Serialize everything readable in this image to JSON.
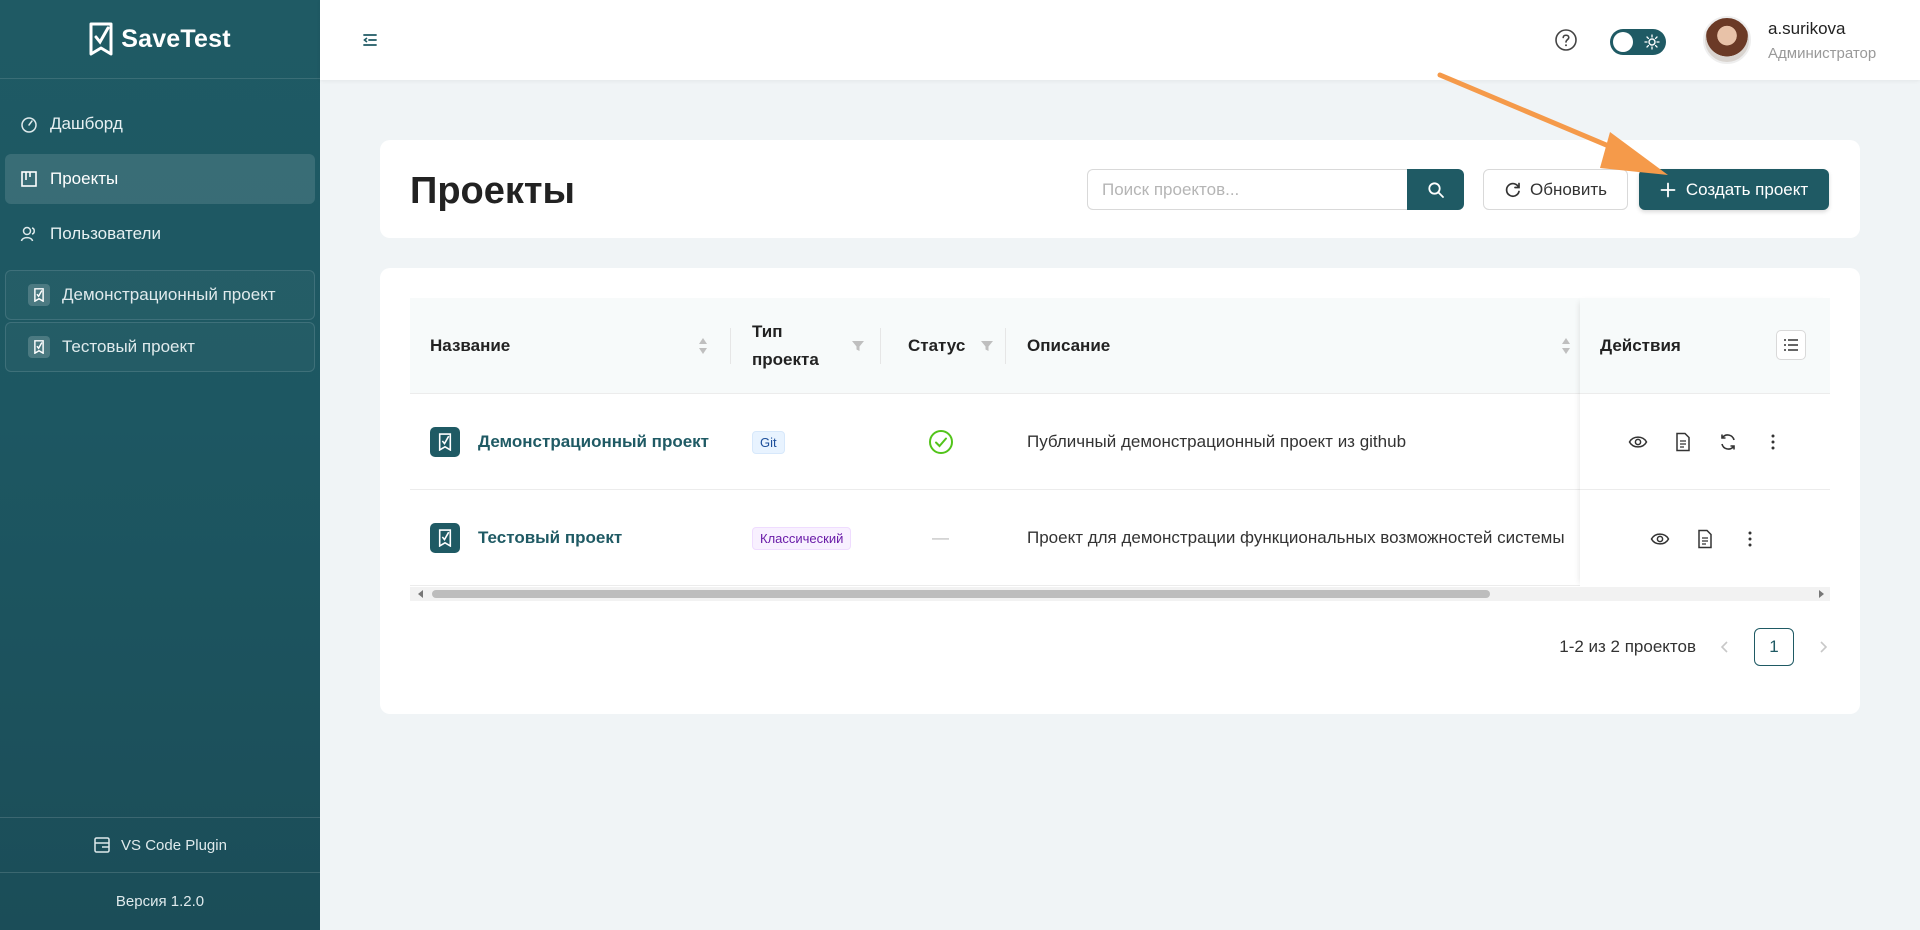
{
  "app": {
    "name": "SaveTest"
  },
  "sidebar": {
    "nav": [
      {
        "label": "Дашборд",
        "icon": "dashboard-icon"
      },
      {
        "label": "Проекты",
        "icon": "projects-icon",
        "active": true
      },
      {
        "label": "Пользователи",
        "icon": "users-icon"
      }
    ],
    "projects": [
      {
        "label": "Демонстрационный проект"
      },
      {
        "label": "Тестовый проект"
      }
    ],
    "plugin_label": "VS Code Plugin",
    "version": "Версия 1.2.0"
  },
  "header": {
    "user_name": "a.surikova",
    "user_role": "Администратор"
  },
  "page": {
    "title": "Проекты",
    "search_placeholder": "Поиск проектов...",
    "refresh_label": "Обновить",
    "create_label": "Создать проект"
  },
  "table": {
    "columns": {
      "name": "Название",
      "type_line1": "Тип",
      "type_line2": "проекта",
      "status": "Статус",
      "description": "Описание",
      "actions": "Действия"
    },
    "rows": [
      {
        "name": "Демонстрационный проект",
        "type": "Git",
        "status": "ok",
        "description": "Публичный демонстрационный проект из github"
      },
      {
        "name": "Тестовый проект",
        "type": "Классический",
        "status": "—",
        "description": "Проект для демонстрации функциональных возможностей системы"
      }
    ]
  },
  "pagination": {
    "summary": "1-2 из 2 проектов",
    "current_page": "1"
  },
  "colors": {
    "primary": "#1f5a64",
    "accent_arrow": "#f59a4a",
    "success": "#52c41a"
  }
}
